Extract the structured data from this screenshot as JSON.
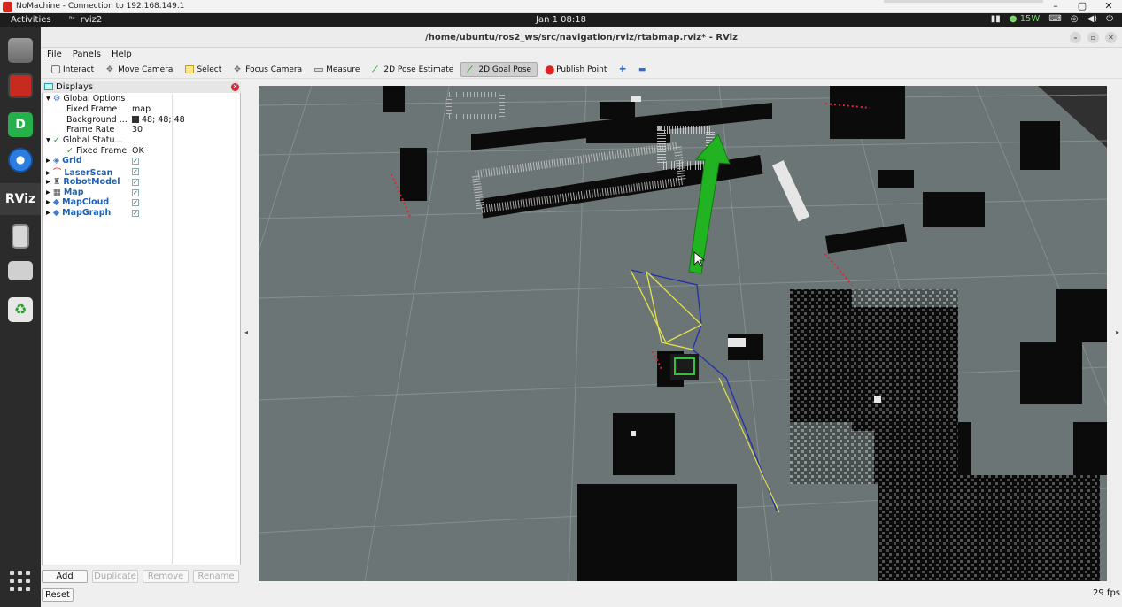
{
  "nomachine": {
    "title": "NoMachine - Connection to 192.168.149.1"
  },
  "topbar": {
    "activities": "Activities",
    "app_name": "rviz2",
    "clock": "Jan 1  08:18",
    "power": "15W"
  },
  "window": {
    "title": "/home/ubuntu/ros2_ws/src/navigation/rviz/rtabmap.rviz* - RViz"
  },
  "menu": {
    "file": "File",
    "panels": "Panels",
    "help": "Help"
  },
  "toolbar": {
    "interact": "Interact",
    "move_camera": "Move Camera",
    "select": "Select",
    "focus_camera": "Focus Camera",
    "measure": "Measure",
    "pose_estimate": "2D Pose Estimate",
    "goal_pose": "2D Goal Pose",
    "publish_point": "Publish Point"
  },
  "displays": {
    "title": "Displays",
    "rows": [
      {
        "key": "Global Options",
        "value": ""
      },
      {
        "key": "Fixed Frame",
        "value": "map"
      },
      {
        "key": "Background ...",
        "value": "48; 48; 48"
      },
      {
        "key": "Frame Rate",
        "value": "30"
      },
      {
        "key": "Global Statu...",
        "value": ""
      },
      {
        "key": "Fixed Frame",
        "value": "OK"
      },
      {
        "key": "Grid",
        "value": "✓"
      },
      {
        "key": "LaserScan",
        "value": "✓"
      },
      {
        "key": "RobotModel",
        "value": "✓"
      },
      {
        "key": "Map",
        "value": "✓"
      },
      {
        "key": "MapCloud",
        "value": "✓"
      },
      {
        "key": "MapGraph",
        "value": "✓"
      }
    ]
  },
  "buttons": {
    "add": "Add",
    "duplicate": "Duplicate",
    "remove": "Remove",
    "rename": "Rename",
    "reset": "Reset"
  },
  "status": {
    "fps": "29 fps"
  },
  "colors": {
    "background": "#303030",
    "grid": "#a0a0a0",
    "goal_arrow": "#1fb81f",
    "laser": "#d02030",
    "graph": "#e0e040"
  }
}
